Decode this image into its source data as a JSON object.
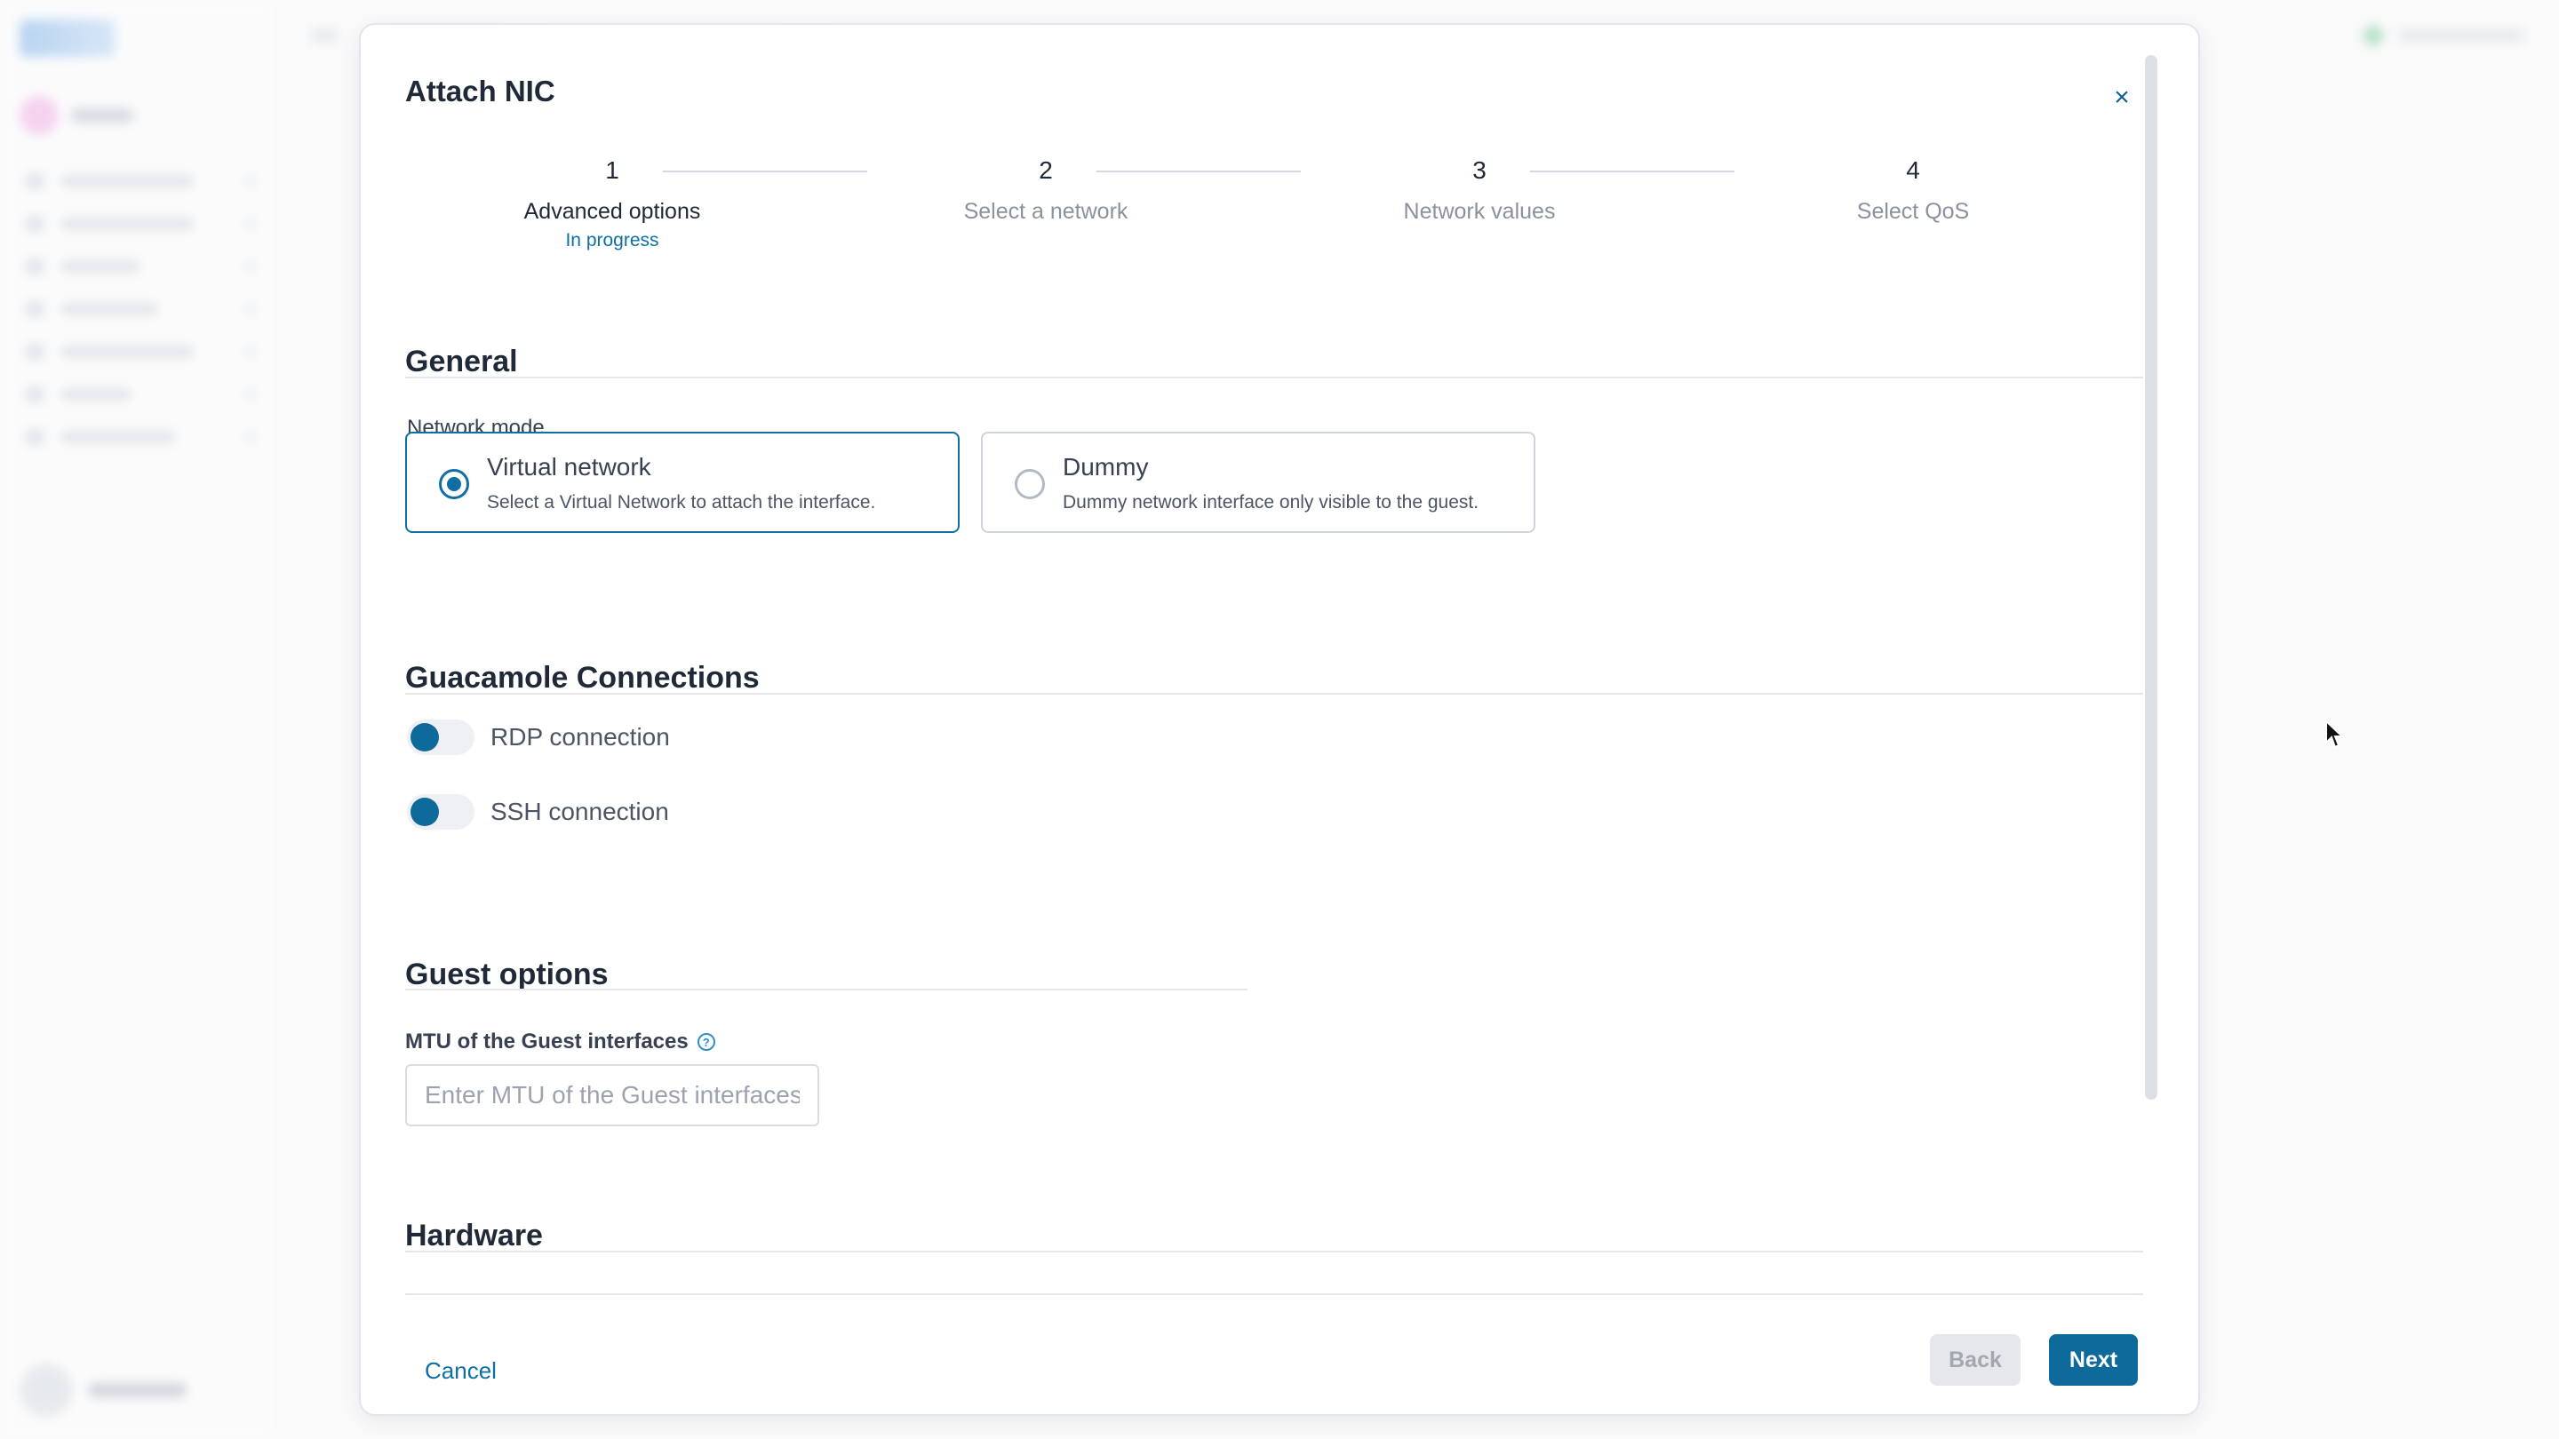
{
  "modal": {
    "title": "Attach NIC",
    "close_glyph": "×"
  },
  "wizard": {
    "steps": [
      {
        "number": "1",
        "label": "Advanced options",
        "status": "In progress"
      },
      {
        "number": "2",
        "label": "Select a network"
      },
      {
        "number": "3",
        "label": "Network values"
      },
      {
        "number": "4",
        "label": "Select QoS"
      }
    ],
    "current_step": 1
  },
  "general": {
    "title": "General",
    "network_mode_label": "Network mode",
    "options": [
      {
        "title": "Virtual network",
        "description": "Select a Virtual Network to attach the interface.",
        "selected": true
      },
      {
        "title": "Dummy",
        "description": "Dummy network interface only visible to the guest.",
        "selected": false
      }
    ]
  },
  "guacamole": {
    "title": "Guacamole Connections",
    "toggles": [
      {
        "label": "RDP connection"
      },
      {
        "label": "SSH connection"
      }
    ]
  },
  "guest_options": {
    "title": "Guest options",
    "mtu_label": "MTU of the Guest interfaces",
    "mtu_value": "",
    "mtu_placeholder": "Enter MTU of the Guest interfaces"
  },
  "hardware": {
    "title": "Hardware"
  },
  "footer": {
    "cancel_label": "Cancel",
    "back_label": "Back",
    "next_label": "Next"
  },
  "colors": {
    "accent": "#0f6fa4",
    "primary_button": "#0f6a9c",
    "disabled_button": "#e5e7ea"
  },
  "icons": {
    "close": "close-icon",
    "help": "help-circle-icon",
    "cursor": "mouse-pointer-icon"
  }
}
